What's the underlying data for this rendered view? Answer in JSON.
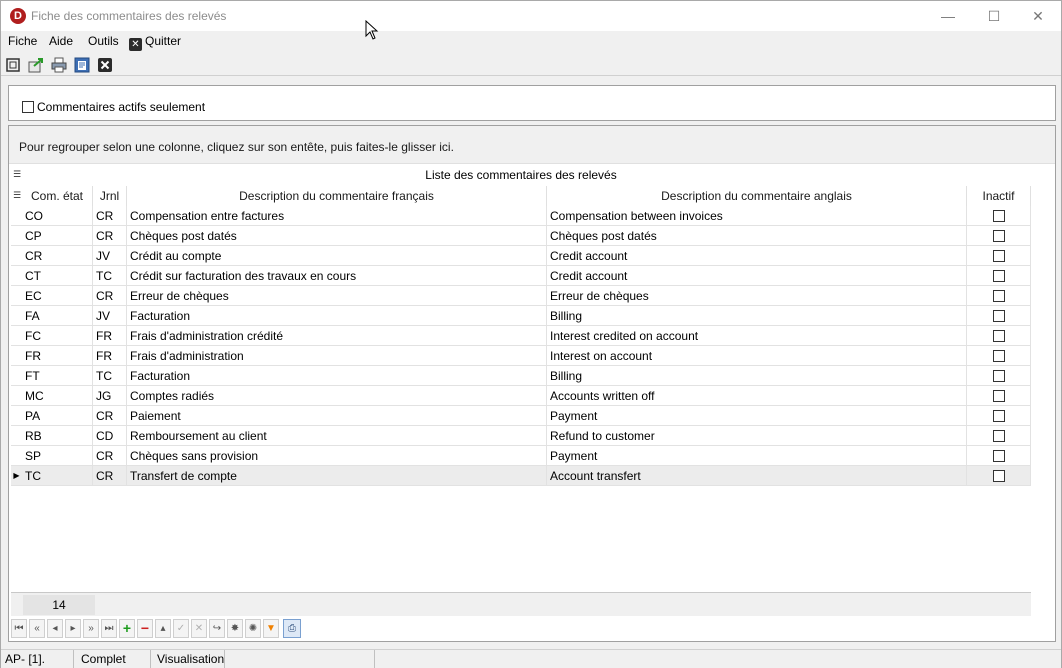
{
  "window": {
    "title": "Fiche des commentaires des relevés",
    "app_icon_letter": "D",
    "minimize": "—",
    "maximize": "☐",
    "close": "✕"
  },
  "menu": {
    "items": [
      "Fiche",
      "Aide",
      "Outils"
    ],
    "quit_label": "Quitter"
  },
  "toolbar": {
    "icons": [
      "maximize-frame-icon",
      "export-icon",
      "print-icon",
      "preview-icon",
      "close-icon"
    ]
  },
  "filter": {
    "active_only_label": "Commentaires actifs seulement",
    "active_only_checked": false
  },
  "grid": {
    "group_hint": "Pour regrouper selon une colonne, cliquez sur son entête, puis faites-le glisser ici.",
    "caption": "Liste des commentaires des relevés",
    "columns": [
      "Com. état",
      "Jrnl",
      "Description du commentaire français",
      "Description du commentaire anglais",
      "Inactif"
    ],
    "rows": [
      {
        "code": "CO",
        "jrnl": "CR",
        "fr": "Compensation entre factures",
        "en": "Compensation between invoices",
        "inactive": false
      },
      {
        "code": "CP",
        "jrnl": "CR",
        "fr": "Chèques post datés",
        "en": "Chèques post datés",
        "inactive": false
      },
      {
        "code": "CR",
        "jrnl": "JV",
        "fr": "Crédit au compte",
        "en": "Credit account",
        "inactive": false
      },
      {
        "code": "CT",
        "jrnl": "TC",
        "fr": "Crédit sur facturation des travaux en cours",
        "en": "Credit account",
        "inactive": false
      },
      {
        "code": "EC",
        "jrnl": "CR",
        "fr": "Erreur de chèques",
        "en": "Erreur de chèques",
        "inactive": false
      },
      {
        "code": "FA",
        "jrnl": "JV",
        "fr": "Facturation",
        "en": "Billing",
        "inactive": false
      },
      {
        "code": "FC",
        "jrnl": "FR",
        "fr": "Frais d'administration crédité",
        "en": "Interest credited on account",
        "inactive": false
      },
      {
        "code": "FR",
        "jrnl": "FR",
        "fr": "Frais d'administration",
        "en": "Interest on account",
        "inactive": false
      },
      {
        "code": "FT",
        "jrnl": "TC",
        "fr": "Facturation",
        "en": "Billing",
        "inactive": false
      },
      {
        "code": "MC",
        "jrnl": "JG",
        "fr": "Comptes radiés",
        "en": "Accounts written off",
        "inactive": false
      },
      {
        "code": "PA",
        "jrnl": "CR",
        "fr": "Paiement",
        "en": "Payment",
        "inactive": false
      },
      {
        "code": "RB",
        "jrnl": "CD",
        "fr": "Remboursement au client",
        "en": "Refund to customer",
        "inactive": false
      },
      {
        "code": "SP",
        "jrnl": "CR",
        "fr": "Chèques sans provision",
        "en": "Payment",
        "inactive": false
      },
      {
        "code": "TC",
        "jrnl": "CR",
        "fr": "Transfert de compte",
        "en": "Account transfert",
        "inactive": false,
        "selected": true
      }
    ],
    "record_count": "14"
  },
  "navigator": {
    "buttons": [
      {
        "name": "first-page-icon",
        "glyph": "⏮"
      },
      {
        "name": "prev-page-icon",
        "glyph": "«"
      },
      {
        "name": "prev-record-icon",
        "glyph": "◂"
      },
      {
        "name": "next-record-icon",
        "glyph": "▸"
      },
      {
        "name": "next-page-icon",
        "glyph": "»"
      },
      {
        "name": "last-page-icon",
        "glyph": "⏭"
      },
      {
        "name": "add-icon",
        "glyph": "+"
      },
      {
        "name": "delete-icon",
        "glyph": "−"
      },
      {
        "name": "edit-icon",
        "glyph": "▴"
      },
      {
        "name": "confirm-icon",
        "glyph": "✓"
      },
      {
        "name": "cancel-icon",
        "glyph": "✕"
      },
      {
        "name": "refresh-icon",
        "glyph": "↪"
      },
      {
        "name": "bookmark-icon",
        "glyph": "✸"
      },
      {
        "name": "goto-bookmark-icon",
        "glyph": "✺"
      },
      {
        "name": "filter-icon",
        "glyph": "▼"
      },
      {
        "name": "print-icon",
        "glyph": "⎙"
      }
    ]
  },
  "status": {
    "cells": [
      "AP- [1].",
      "Complet",
      "Visualisation",
      ""
    ]
  }
}
